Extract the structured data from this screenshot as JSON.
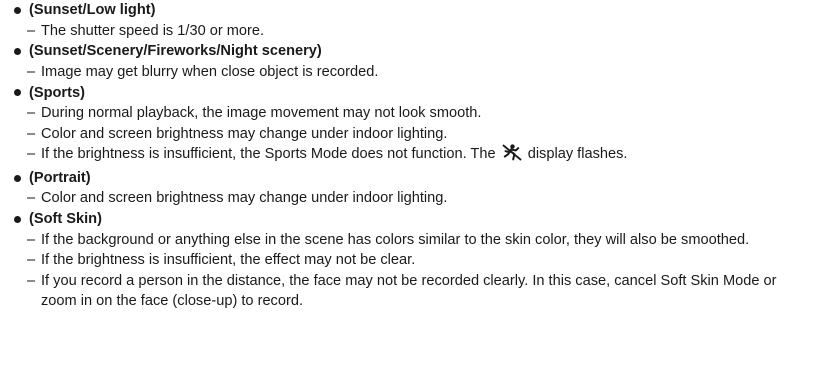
{
  "dash": "–",
  "sections": [
    {
      "title": "(Sunset/Low light)",
      "notes": [
        "The shutter speed is 1/30 or more."
      ]
    },
    {
      "title": "(Sunset/Scenery/Fireworks/Night scenery)",
      "notes": [
        "Image may get blurry when close object is recorded."
      ]
    },
    {
      "title": "(Sports)",
      "notes": [
        "During normal playback, the image movement may not look smooth.",
        "Color and screen brightness may change under indoor lighting.",
        {
          "before": "If the brightness is insufficient, the Sports Mode does not function. The",
          "icon": "sports-mode-icon",
          "after": "display flashes."
        }
      ]
    },
    {
      "title": "(Portrait)",
      "notes": [
        "Color and screen brightness may change under indoor lighting."
      ]
    },
    {
      "title": "(Soft Skin)",
      "notes": [
        "If the background or anything else in the scene has colors similar to the skin color, they will also be smoothed.",
        "If the brightness is insufficient, the effect may not be clear.",
        "If you record a person in the distance, the face may not be recorded clearly. In this case, cancel Soft Skin Mode or zoom in on the face (close-up) to record."
      ]
    }
  ]
}
